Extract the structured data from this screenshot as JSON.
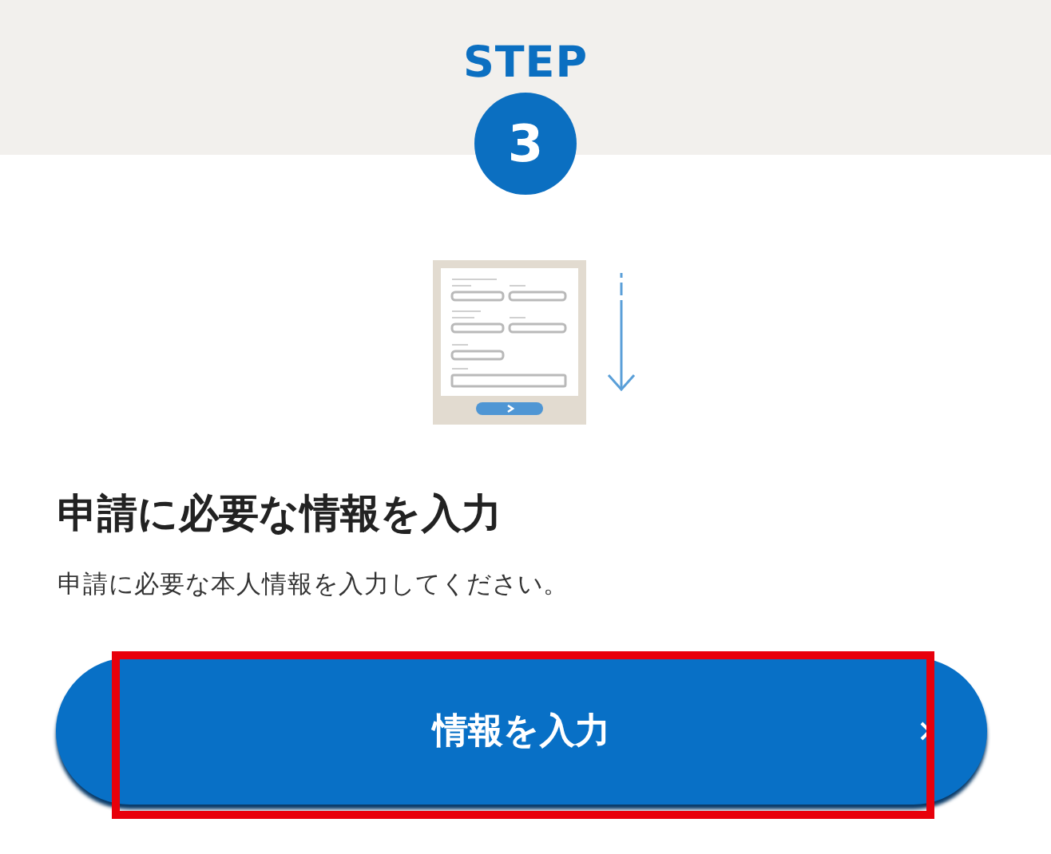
{
  "step": {
    "label": "STEP",
    "number": "3"
  },
  "heading": "申請に必要な情報を入力",
  "description": "申請に必要な本人情報を入力してください。",
  "button": {
    "label": "情報を入力",
    "highlighted": true
  }
}
